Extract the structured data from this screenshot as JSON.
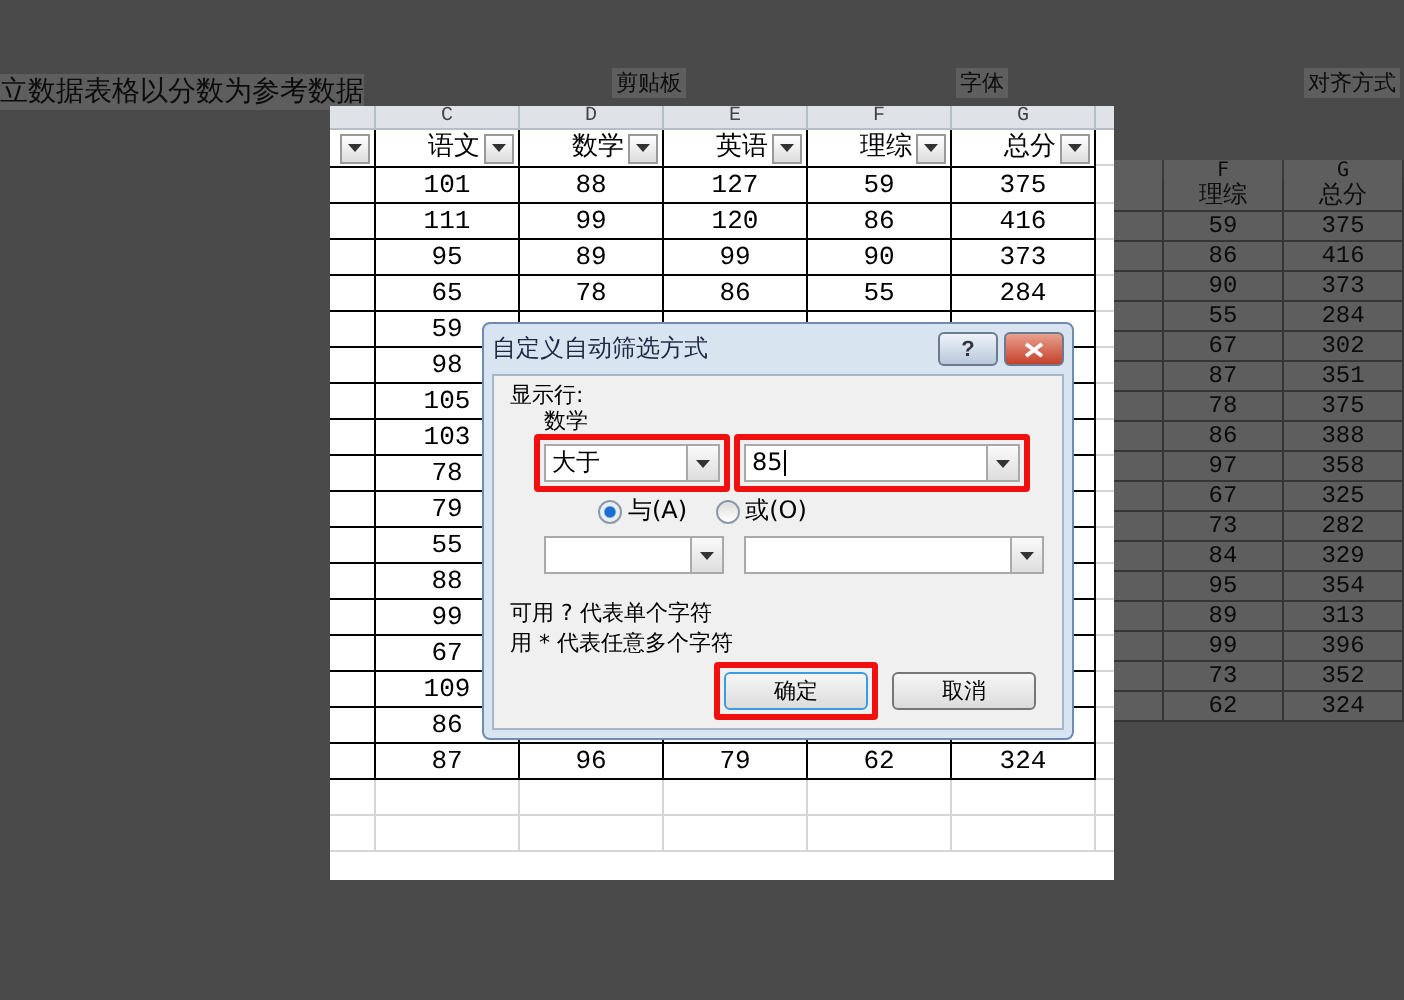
{
  "background": {
    "title": "立数据表格以分数为参考数据",
    "ribbon_groups": [
      "剪贴板",
      "字体",
      "对齐方式"
    ],
    "sheet": {
      "columns": [
        {
          "letter": "F",
          "header": "理综"
        },
        {
          "letter": "G",
          "header": "总分"
        }
      ],
      "rows": [
        [
          "59",
          "375"
        ],
        [
          "86",
          "416"
        ],
        [
          "90",
          "373"
        ],
        [
          "55",
          "284"
        ],
        [
          "67",
          "302"
        ],
        [
          "87",
          "351"
        ],
        [
          "78",
          "375"
        ],
        [
          "86",
          "388"
        ],
        [
          "97",
          "358"
        ],
        [
          "67",
          "325"
        ],
        [
          "73",
          "282"
        ],
        [
          "84",
          "329"
        ],
        [
          "95",
          "354"
        ],
        [
          "89",
          "313"
        ],
        [
          "99",
          "396"
        ],
        [
          "73",
          "352"
        ],
        [
          "62",
          "324"
        ]
      ]
    }
  },
  "sheet": {
    "columns": [
      {
        "letter": "C",
        "header": "语文"
      },
      {
        "letter": "D",
        "header": "数学"
      },
      {
        "letter": "E",
        "header": "英语"
      },
      {
        "letter": "F",
        "header": "理综"
      },
      {
        "letter": "G",
        "header": "总分"
      }
    ],
    "rows": [
      [
        "101",
        "88",
        "127",
        "59",
        "375"
      ],
      [
        "111",
        "99",
        "120",
        "86",
        "416"
      ],
      [
        "95",
        "89",
        "99",
        "90",
        "373"
      ],
      [
        "65",
        "78",
        "86",
        "55",
        "284"
      ],
      [
        "59"
      ],
      [
        "98"
      ],
      [
        "105"
      ],
      [
        "103"
      ],
      [
        "78"
      ],
      [
        "79"
      ],
      [
        "55"
      ],
      [
        "88"
      ],
      [
        "99"
      ],
      [
        "67"
      ],
      [
        "109"
      ],
      [
        "86"
      ],
      [
        "87",
        "96",
        "79",
        "62",
        "324"
      ]
    ]
  },
  "dialog": {
    "title": "自定义自动筛选方式",
    "help": "?",
    "show_rows_label": "显示行:",
    "field": "数学",
    "condition1": {
      "operator": "大于",
      "value": "85",
      "highlighted": true
    },
    "logic": [
      {
        "label": "与(A)",
        "selected": true
      },
      {
        "label": "或(O)",
        "selected": false
      }
    ],
    "hints": [
      "可用 ? 代表单个字符",
      "用 * 代表任意多个字符"
    ],
    "buttons": [
      {
        "label": "确定",
        "highlighted": true,
        "default": true
      },
      {
        "label": "取消",
        "highlighted": false,
        "default": false
      }
    ]
  }
}
